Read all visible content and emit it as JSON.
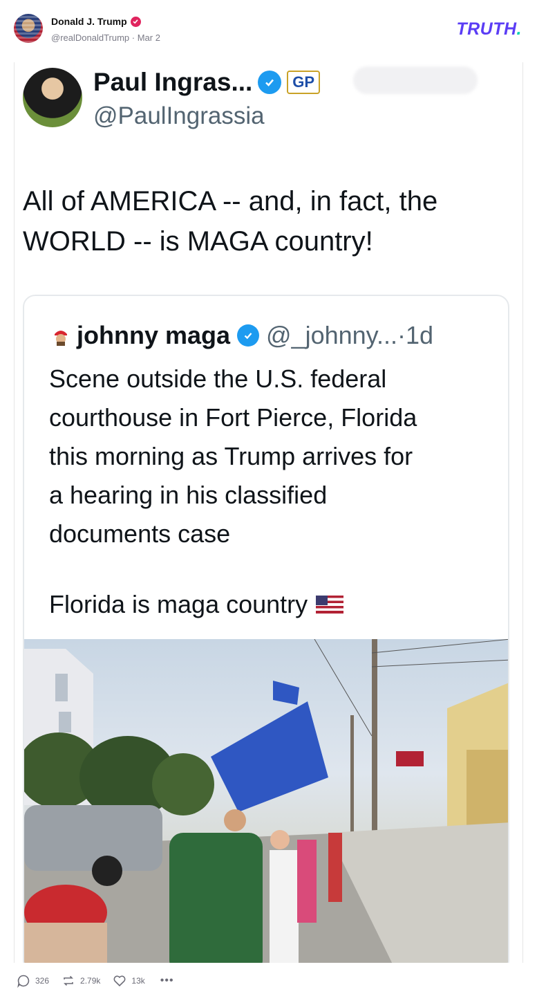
{
  "post": {
    "author_name": "Donald J. Trump",
    "author_handle_date": "@realDonaldTrump · Mar 2",
    "brand": "TRUTH",
    "brand_dot": "."
  },
  "embedded": {
    "name": "Paul Ingras...",
    "gp_label": "GP",
    "handle": "@PaulIngrassia",
    "text_line1": "All of AMERICA -- and, in fact, the",
    "text_line2": "WORLD -- is MAGA country!",
    "quote": {
      "name": "johnny maga",
      "handle_time": "@_johnny...·1d",
      "lines": [
        "Scene outside the U.S. federal",
        "courthouse in Fort Pierce, Florida",
        "this morning as Trump arrives for",
        "a hearing in his classified",
        "documents case"
      ],
      "closing": "Florida is maga country"
    }
  },
  "actions": {
    "replies": "326",
    "retruths": "2.79k",
    "likes": "13k",
    "more": "•••"
  },
  "colors": {
    "brand": "#5b3df5",
    "brand_dot": "#00d1b2",
    "verified": "#e0245e",
    "twitter_blue": "#1d9bf0"
  },
  "icons": [
    "verified-badge-icon",
    "reply-icon",
    "retruth-icon",
    "like-icon",
    "more-icon",
    "flag-icon"
  ]
}
